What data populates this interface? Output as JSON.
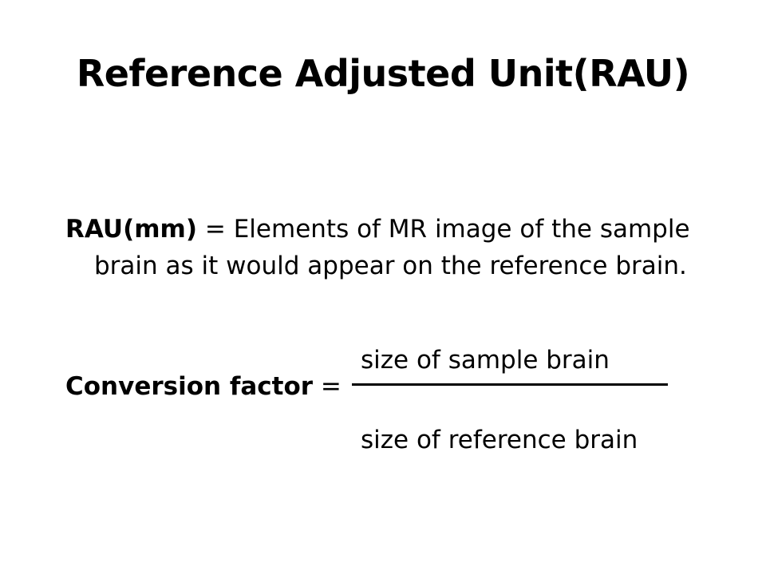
{
  "slide": {
    "title": "Reference Adjusted Unit(RAU)",
    "definition": {
      "term": "RAU(mm)",
      "operator": " = ",
      "text": "Elements of MR image of the sample brain as it would appear on the reference brain."
    },
    "conversion": {
      "term": "Conversion factor",
      "operator": " = ",
      "numerator": "size of sample brain",
      "denominator": "size of reference brain"
    }
  }
}
